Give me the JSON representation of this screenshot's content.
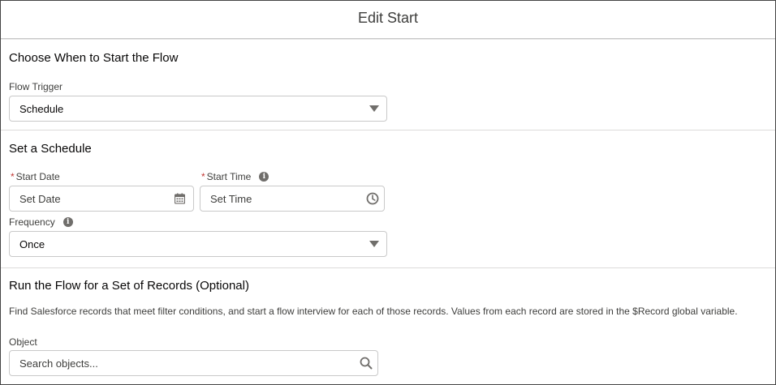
{
  "modal": {
    "title": "Edit Start"
  },
  "start_section": {
    "title": "Choose When to Start the Flow",
    "flow_trigger_label": "Flow Trigger",
    "flow_trigger_value": "Schedule"
  },
  "schedule_section": {
    "title": "Set a Schedule",
    "start_date_label": "Start Date",
    "start_date_placeholder": "Set Date",
    "start_time_label": "Start Time",
    "start_time_placeholder": "Set Time",
    "frequency_label": "Frequency",
    "frequency_value": "Once",
    "required_marker": "*"
  },
  "records_section": {
    "title": "Run the Flow for a Set of Records (Optional)",
    "description": "Find Salesforce records that meet filter conditions, and start a flow interview for each of those records. Values from each record are stored in the $Record global variable.",
    "object_label": "Object",
    "object_placeholder": "Search objects..."
  },
  "icons": {
    "info": "i"
  },
  "colors": {
    "required": "#c23934",
    "icon": "#706e6b",
    "border": "#c9c9c9"
  }
}
